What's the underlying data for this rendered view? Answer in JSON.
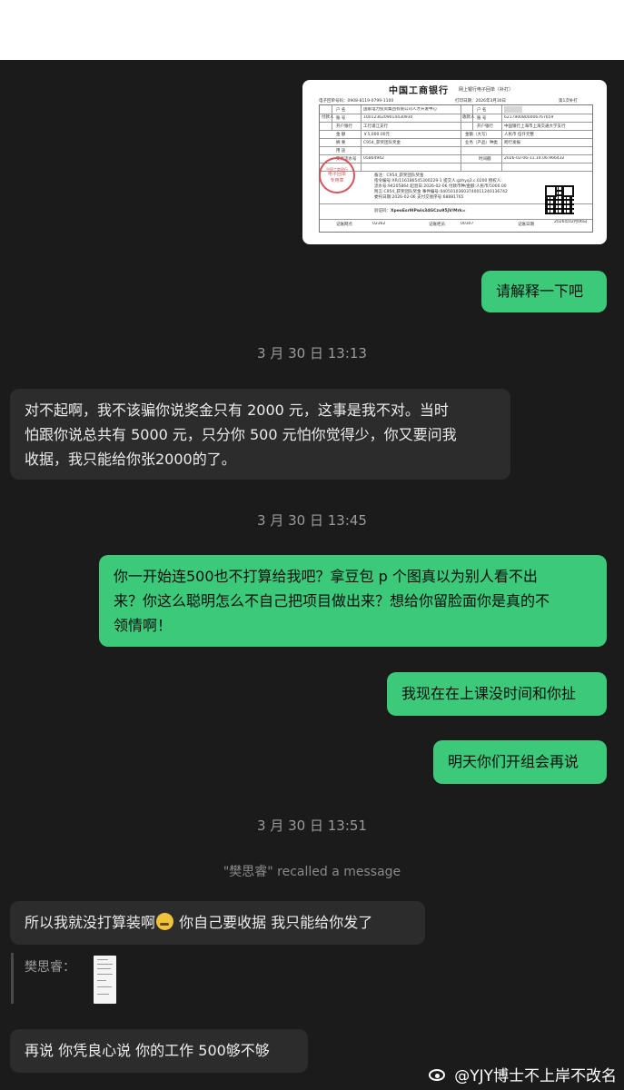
{
  "receipt": {
    "bank_title": "中国工商银行",
    "subtitle": "网上银行电子回单（补打）",
    "receipt_no_label": "电子回单号码：",
    "receipt_no": "0908-8119-0799-1100",
    "print_date_label": "打印日期：",
    "print_date": "2026年3月30日",
    "print_count": "第1次补打",
    "payer_label": "付款人",
    "payee_label": "收款人",
    "account_name_label": "户  名",
    "account_no_label": "账  号",
    "bank_label": "开户银行",
    "payer_name": "国家电力投资集团有限公司人才开发中心",
    "payer_account": "1001236209014430930",
    "payer_bank": "工行浦江支行",
    "payee_account": "6217900800006767659",
    "payee_bank": "中国银行上海市上海交通大学支行",
    "amount_label": "金  额",
    "amount": "￥5,000.00元",
    "amount_upper_label": "金额（大写）",
    "amount_upper": "人民币 伍仟元整",
    "summary_label": "摘  要",
    "summary": "C954_获奖团队奖金",
    "business_label": "业务（产品）种类",
    "business": "跨行发报",
    "purpose_label": "用  途",
    "serial_label": "交易流水号",
    "serial": "05864942",
    "time_label": "时间戳",
    "time": "2026-02-06-11.14.06.966432",
    "note_lines": [
      "备注：C954_获奖团队奖金",
      "指令编号:XR/116186545300229-1 提交人:gzhyq3.c.0200 授权人:",
      "流水号:94205864 起息日:2026-02-06 付款币种/金额:人民币/5000.00",
      "附言:C954_获奖团队奖金 事件编号:04050103603740011240136742",
      "委托日期:2026-02-06 支付交易序号:68881765"
    ],
    "verify_label": "验证码：",
    "verify_code": "XpeoEsr9lPwis34GCzu95jV/Mrk=",
    "seal_text": [
      "中国工商银行",
      "电子回单",
      "专用章"
    ],
    "footer_branch_label": "记账网点",
    "footer_branch": "02362",
    "footer_teller_label": "记账柜员",
    "footer_teller": "00307",
    "footer_date_label": "记账日期",
    "footer_date": "2026年02月06日"
  },
  "messages": [
    {
      "text": "请解释一下吧"
    },
    {
      "text": "对不起啊，我不该骗你说奖金只有 2000 元，这事是我不对。当时\n怕跟你说总共有 5000 元，只分你 500 元怕你觉得少，你又要问我\n收据，我只能给你张2000的了。"
    },
    {
      "text": "你一开始连500也不打算给我吧？拿豆包 p 个图真以为别人看不出\n来？你这么聪明怎么不自己把项目做出来？想给你留脸面你是真的不\n领情啊！"
    },
    {
      "text": "我现在在上课没时间和你扯"
    },
    {
      "text": "明天你们开组会再说"
    },
    {
      "text_before": "所以我就没打算装啊",
      "text_after": " 你自己要收据  我只能给你发了"
    },
    {
      "text": "再说 你凭良心说 你的工作 500够不够"
    }
  ],
  "timestamps": [
    "3 月 30 日 13:13",
    "3 月 30 日 13:45",
    "3 月 30 日 13:51"
  ],
  "system_notice": "\"樊思睿\" recalled a message",
  "quote": {
    "sender": "樊思睿："
  },
  "watermark": "@YJY博士不上岸不改名",
  "colors": {
    "background": "#1b1b1b",
    "outgoing_bubble": "#3cc97a",
    "incoming_bubble": "#2c2c2c"
  }
}
